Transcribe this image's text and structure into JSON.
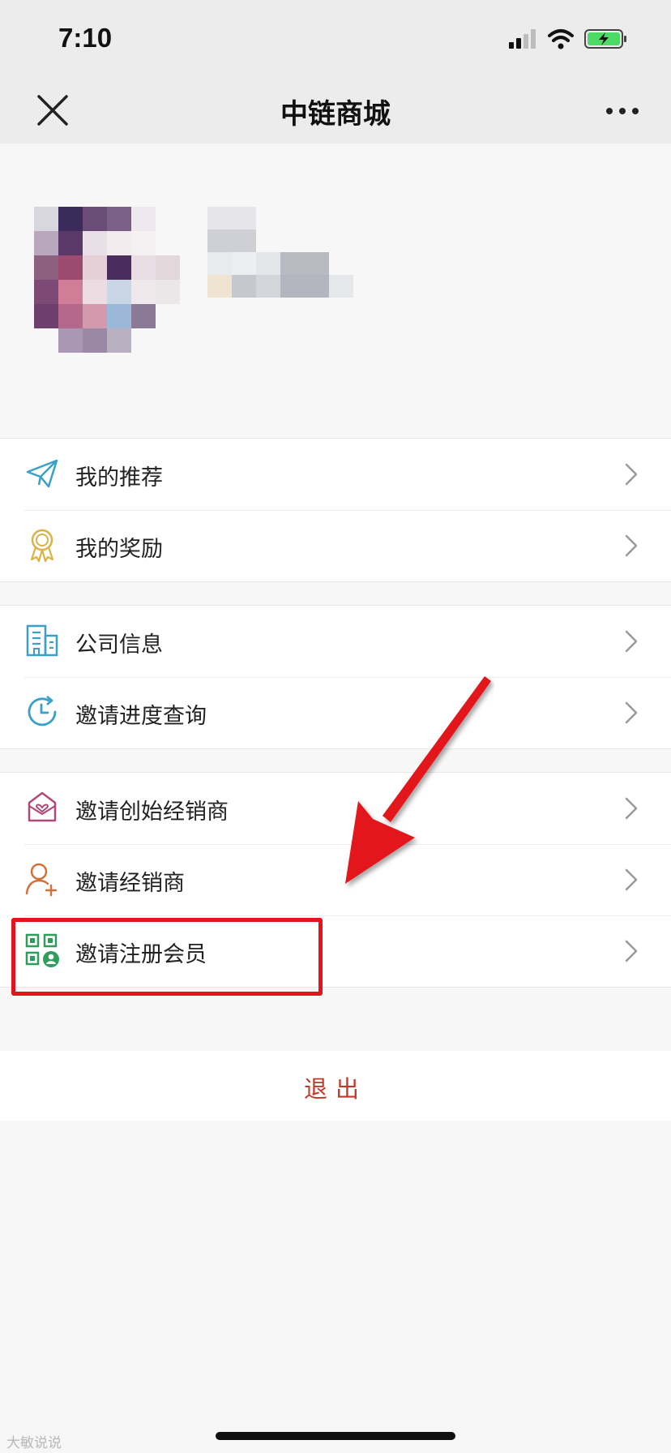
{
  "status_bar": {
    "time": "7:10"
  },
  "nav": {
    "title": "中链商城"
  },
  "menu": {
    "group1": [
      {
        "label": "我的推荐",
        "icon": "paper-plane-icon"
      },
      {
        "label": "我的奖励",
        "icon": "award-medal-icon"
      }
    ],
    "group2": [
      {
        "label": "公司信息",
        "icon": "building-icon"
      },
      {
        "label": "邀请进度查询",
        "icon": "clock-refresh-icon"
      }
    ],
    "group3": [
      {
        "label": "邀请创始经销商",
        "icon": "heart-envelope-icon"
      },
      {
        "label": "邀请经销商",
        "icon": "add-user-icon"
      },
      {
        "label": "邀请注册会员",
        "icon": "qr-code-user-icon"
      }
    ]
  },
  "logout": {
    "label": "退出"
  },
  "colors": {
    "accent_red": "#e3141c",
    "logout_text": "#c0392b"
  },
  "watermark": {
    "text": "大敏说说"
  }
}
